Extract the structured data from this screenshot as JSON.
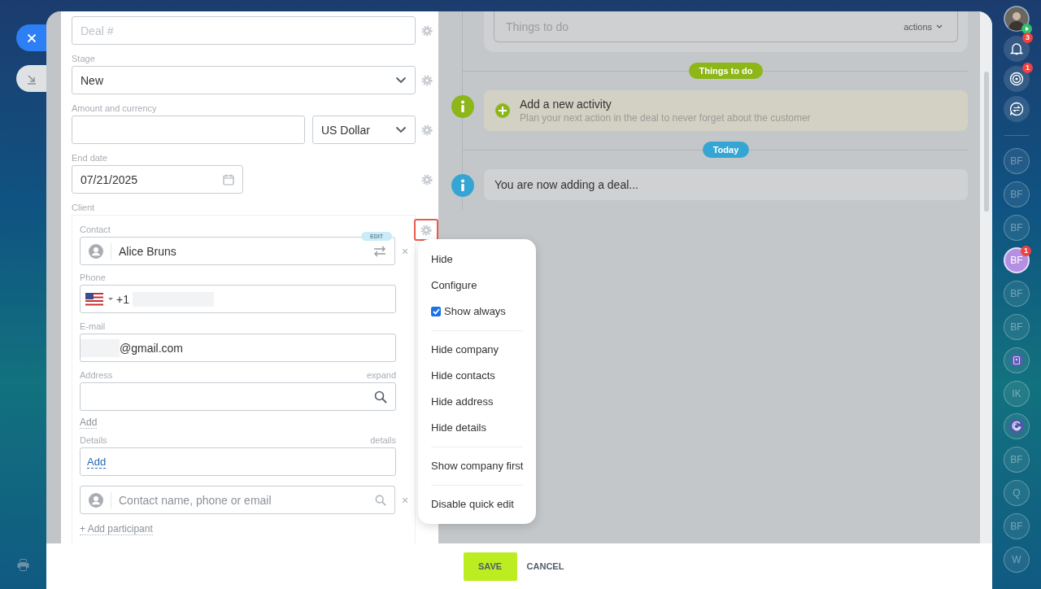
{
  "deal_form": {
    "fields": [
      {
        "kind": "input",
        "placeholder": "Deal #"
      },
      {
        "kind": "select",
        "label": "Stage",
        "value": "New"
      },
      {
        "kind": "amount",
        "label": "Amount and currency",
        "currency": "US Dollar"
      },
      {
        "kind": "date",
        "label": "End date",
        "value": "07/21/2025"
      }
    ],
    "client": {
      "label": "Client",
      "contact_label": "Contact",
      "contact_name": "Alice Bruns",
      "edit_badge": "EDIT",
      "remove": "×",
      "settings_highlighted": true,
      "phone": {
        "label": "Phone",
        "code": "+1"
      },
      "email": {
        "label": "E-mail",
        "value": "@gmail.com"
      },
      "address": {
        "label": "Address",
        "action": "expand",
        "add_link": "Add"
      },
      "details": {
        "label": "Details",
        "action": "details",
        "add_link": "Add"
      },
      "search": {
        "placeholder": "Contact name, phone or email",
        "remove": "×"
      },
      "add_participant": "+ Add participant"
    }
  },
  "menu": {
    "items": [
      {
        "kind": "item",
        "label": "Hide"
      },
      {
        "kind": "item",
        "label": "Configure"
      },
      {
        "kind": "checkbox",
        "label": "Show always",
        "checked": true
      },
      {
        "kind": "divider"
      },
      {
        "kind": "item",
        "label": "Hide company"
      },
      {
        "kind": "item",
        "label": "Hide contacts"
      },
      {
        "kind": "item",
        "label": "Hide address"
      },
      {
        "kind": "item",
        "label": "Hide details"
      },
      {
        "kind": "divider"
      },
      {
        "kind": "item",
        "label": "Show company first"
      },
      {
        "kind": "divider"
      },
      {
        "kind": "item",
        "label": "Disable quick edit"
      }
    ]
  },
  "timeline": {
    "composer": {
      "placeholder": "Things to do",
      "actions": "actions"
    },
    "sections": [
      {
        "label": "Things to do",
        "color": "#8db619",
        "entries": [
          {
            "kind": "activity",
            "title": "Add a new activity",
            "subtitle": "Plan your next action in the deal to never forget about the customer"
          }
        ]
      },
      {
        "label": "Today",
        "color": "#35a6d4",
        "entries": [
          {
            "kind": "info",
            "text": "You are now adding a deal..."
          }
        ]
      }
    ]
  },
  "footer": {
    "buttons": [
      {
        "kind": "primary",
        "label": "SAVE"
      },
      {
        "kind": "link",
        "label": "CANCEL"
      }
    ]
  },
  "right_bar": {
    "notifications": [
      {
        "kind": "bell",
        "badge": "3"
      },
      {
        "kind": "target",
        "badge": "1"
      },
      {
        "kind": "chat"
      }
    ],
    "contacts": [
      {
        "kind": "initials",
        "text": "BF",
        "selected": false
      },
      {
        "kind": "initials",
        "text": "BF",
        "selected": false
      },
      {
        "kind": "initials",
        "text": "BF",
        "selected": false
      },
      {
        "kind": "initials",
        "text": "BF",
        "selected": true,
        "badge": "1"
      },
      {
        "kind": "initials",
        "text": "BF",
        "selected": false
      },
      {
        "kind": "initials",
        "text": "BF",
        "selected": false
      },
      {
        "kind": "book",
        "selected": false
      },
      {
        "kind": "initials",
        "text": "IK",
        "selected": false
      },
      {
        "kind": "swirl",
        "selected": false
      },
      {
        "kind": "initials",
        "text": "BF",
        "selected": false
      },
      {
        "kind": "initials",
        "text": "Q",
        "selected": false
      },
      {
        "kind": "initials",
        "text": "BF",
        "selected": false
      },
      {
        "kind": "initials",
        "text": "W",
        "selected": false
      }
    ]
  }
}
